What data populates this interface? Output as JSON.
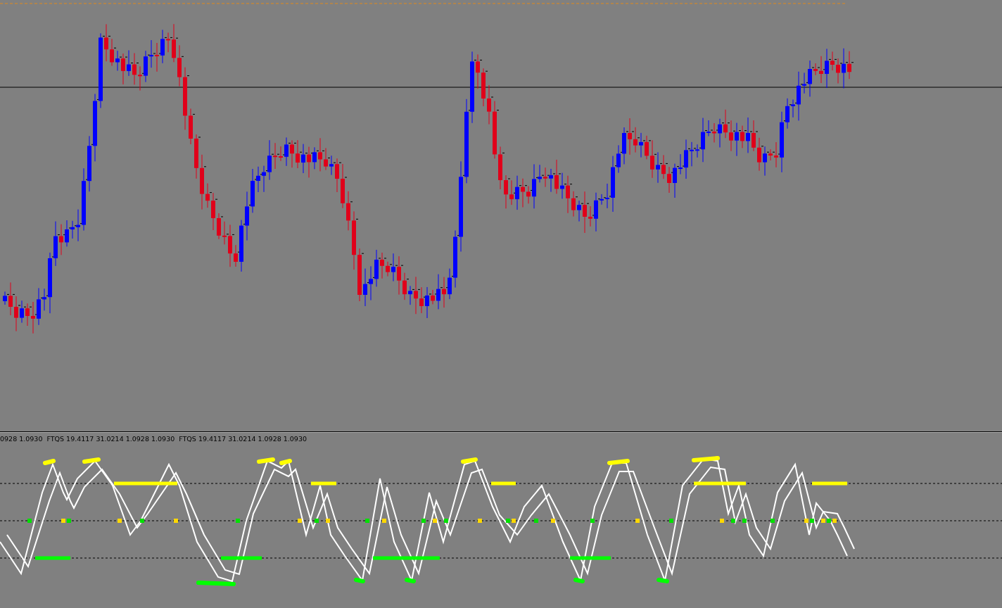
{
  "indicator_pane": {
    "label": "0928 1.0930  FTQS 19.4117 31.0214 1.0928 1.0930  FTQS 19.4117 31.0214 1.0928 1.0930"
  }
}
